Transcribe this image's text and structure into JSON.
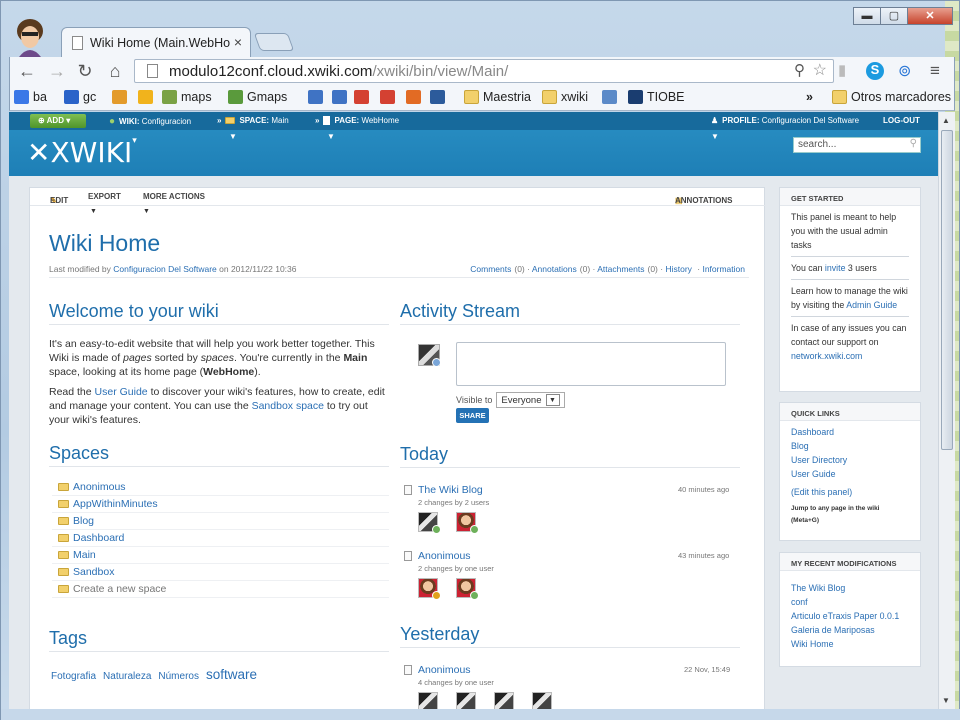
{
  "browser": {
    "tab_title": "Wiki Home (Main.WebHo",
    "tab_close": "×",
    "url_host": "modulo12conf.cloud.xwiki.com",
    "url_path": "/xwiki/bin/view/Main/",
    "window_buttons": {
      "minimize": "▬",
      "maximize": "▢",
      "close": "✕"
    },
    "bookmarks": [
      {
        "label": "ba",
        "icon": "google-icon",
        "color": "#3b78e7"
      },
      {
        "label": "gc",
        "icon": "calendar-icon",
        "color": "#2a63c9"
      },
      {
        "label": "",
        "icon": "bookmark-icon",
        "color": "#e39b2b"
      },
      {
        "label": "",
        "icon": "bookmark-icon",
        "color": "#f1b31c"
      },
      {
        "label": "maps",
        "icon": "maps-icon",
        "color": "#7aa245"
      },
      {
        "label": "Gmaps",
        "icon": "gmaps-icon",
        "color": "#5a9a3c"
      },
      {
        "label": "",
        "icon": "app-icon",
        "color": "#3f73c4"
      },
      {
        "label": "",
        "icon": "app-icon",
        "color": "#3f73c4"
      },
      {
        "label": "",
        "icon": "gplus-icon",
        "color": "#d44132"
      },
      {
        "label": "",
        "icon": "gmail-icon",
        "color": "#d44132"
      },
      {
        "label": "",
        "icon": "office-icon",
        "color": "#e26b24"
      },
      {
        "label": "",
        "icon": "m-icon",
        "color": "#2c5b9b"
      },
      {
        "label": "Maestria",
        "icon": "folder-icon",
        "color": "#f2d06b"
      },
      {
        "label": "xwiki",
        "icon": "folder-icon",
        "color": "#f2d06b"
      },
      {
        "label": "",
        "icon": "chart-icon",
        "color": "#5b8ac8"
      },
      {
        "label": "TIOBE",
        "icon": "tiobe-icon",
        "color": "#1a3d70"
      }
    ],
    "bookmarks_more": "»",
    "other_bookmarks": "Otros marcadores"
  },
  "xwiki": {
    "add_label": "ADD",
    "wiki_crumb": "WIKI:",
    "wiki_name": "Configuracion",
    "space_crumb": "SPACE:",
    "space_name": "Main",
    "page_crumb": "PAGE:",
    "page_name": "WebHome",
    "profile_label": "PROFILE:",
    "profile_name": "Configuracion Del Software",
    "logout": "LOG-OUT",
    "logo": "XWIKI",
    "search_placeholder": "search..."
  },
  "actions": {
    "edit": "EDIT",
    "export": "EXPORT",
    "more": "MORE ACTIONS",
    "annotations": "ANNOTATIONS"
  },
  "page": {
    "title": "Wiki Home",
    "lastmod_prefix": "Last modified by",
    "lastmod_user": "Configuracion Del Software",
    "lastmod_date": "on 2012/11/22 10:36",
    "meta": [
      {
        "label": "Comments",
        "count": "(0)"
      },
      {
        "label": "Annotations",
        "count": "(0)"
      },
      {
        "label": "Attachments",
        "count": "(0)"
      },
      {
        "label": "History",
        "count": ""
      },
      {
        "label": "Information",
        "count": ""
      }
    ]
  },
  "welcome": {
    "heading": "Welcome to your wiki",
    "p1_a": "It's an easy-to-edit website that will help you work better together. This Wiki is made of ",
    "p1_pages": "pages",
    "p1_b": " sorted by ",
    "p1_spaces": "spaces",
    "p1_c": ". You're currently in the ",
    "p1_main": "Main",
    "p1_d": " space, looking at its home page (",
    "p1_webhome": "WebHome",
    "p1_e": ").",
    "p2_a": "Read the ",
    "p2_guide": "User Guide",
    "p2_b": " to discover your wiki's features, how to create, edit and manage your content. You can use the ",
    "p2_sandbox": "Sandbox space",
    "p2_c": " to try out your wiki's features."
  },
  "spaces": {
    "heading": "Spaces",
    "items": [
      "Anonimous",
      "AppWithinMinutes",
      "Blog",
      "Dashboard",
      "Main",
      "Sandbox"
    ],
    "create": "Create a new space"
  },
  "tags": {
    "heading": "Tags",
    "items": [
      "Fotografia",
      "Naturaleza",
      "Números",
      "software"
    ]
  },
  "activity": {
    "heading": "Activity Stream",
    "visible_to": "Visible to",
    "visibility": "Everyone",
    "share": "SHARE",
    "today": "Today",
    "yesterday": "Yesterday",
    "entries": [
      {
        "title": "The Wiki Blog",
        "sub": "2 changes by 2 users",
        "time": "40 minutes ago"
      },
      {
        "title": "Anonimous",
        "sub": "2 changes by one user",
        "time": "43 minutes ago"
      },
      {
        "title": "Anonimous",
        "sub": "4 changes by one user",
        "time": "22 Nov, 15:49"
      }
    ]
  },
  "get_started": {
    "heading": "GET STARTED",
    "t1": "This panel is meant to help you with the usual admin tasks",
    "t2_a": "You can ",
    "t2_link": "invite",
    "t2_b": " 3 users",
    "t3_a": "Learn how to manage the wiki by visiting the ",
    "t3_link": "Admin Guide",
    "t4_a": "In case of any issues you can contact our support on ",
    "t4_link": "network.xwiki.com"
  },
  "quick_links": {
    "heading": "QUICK LINKS",
    "items": [
      "Dashboard",
      "Blog",
      "User Directory",
      "User Guide"
    ],
    "edit": "(Edit this panel)",
    "jump": "Jump to any page in the wiki (Meta+G)"
  },
  "recent": {
    "heading": "MY RECENT MODIFICATIONS",
    "items": [
      "The Wiki Blog",
      "conf",
      "Articulo eTraxis Paper 0.0.1",
      "Galeria de Mariposas",
      "Wiki Home"
    ]
  }
}
